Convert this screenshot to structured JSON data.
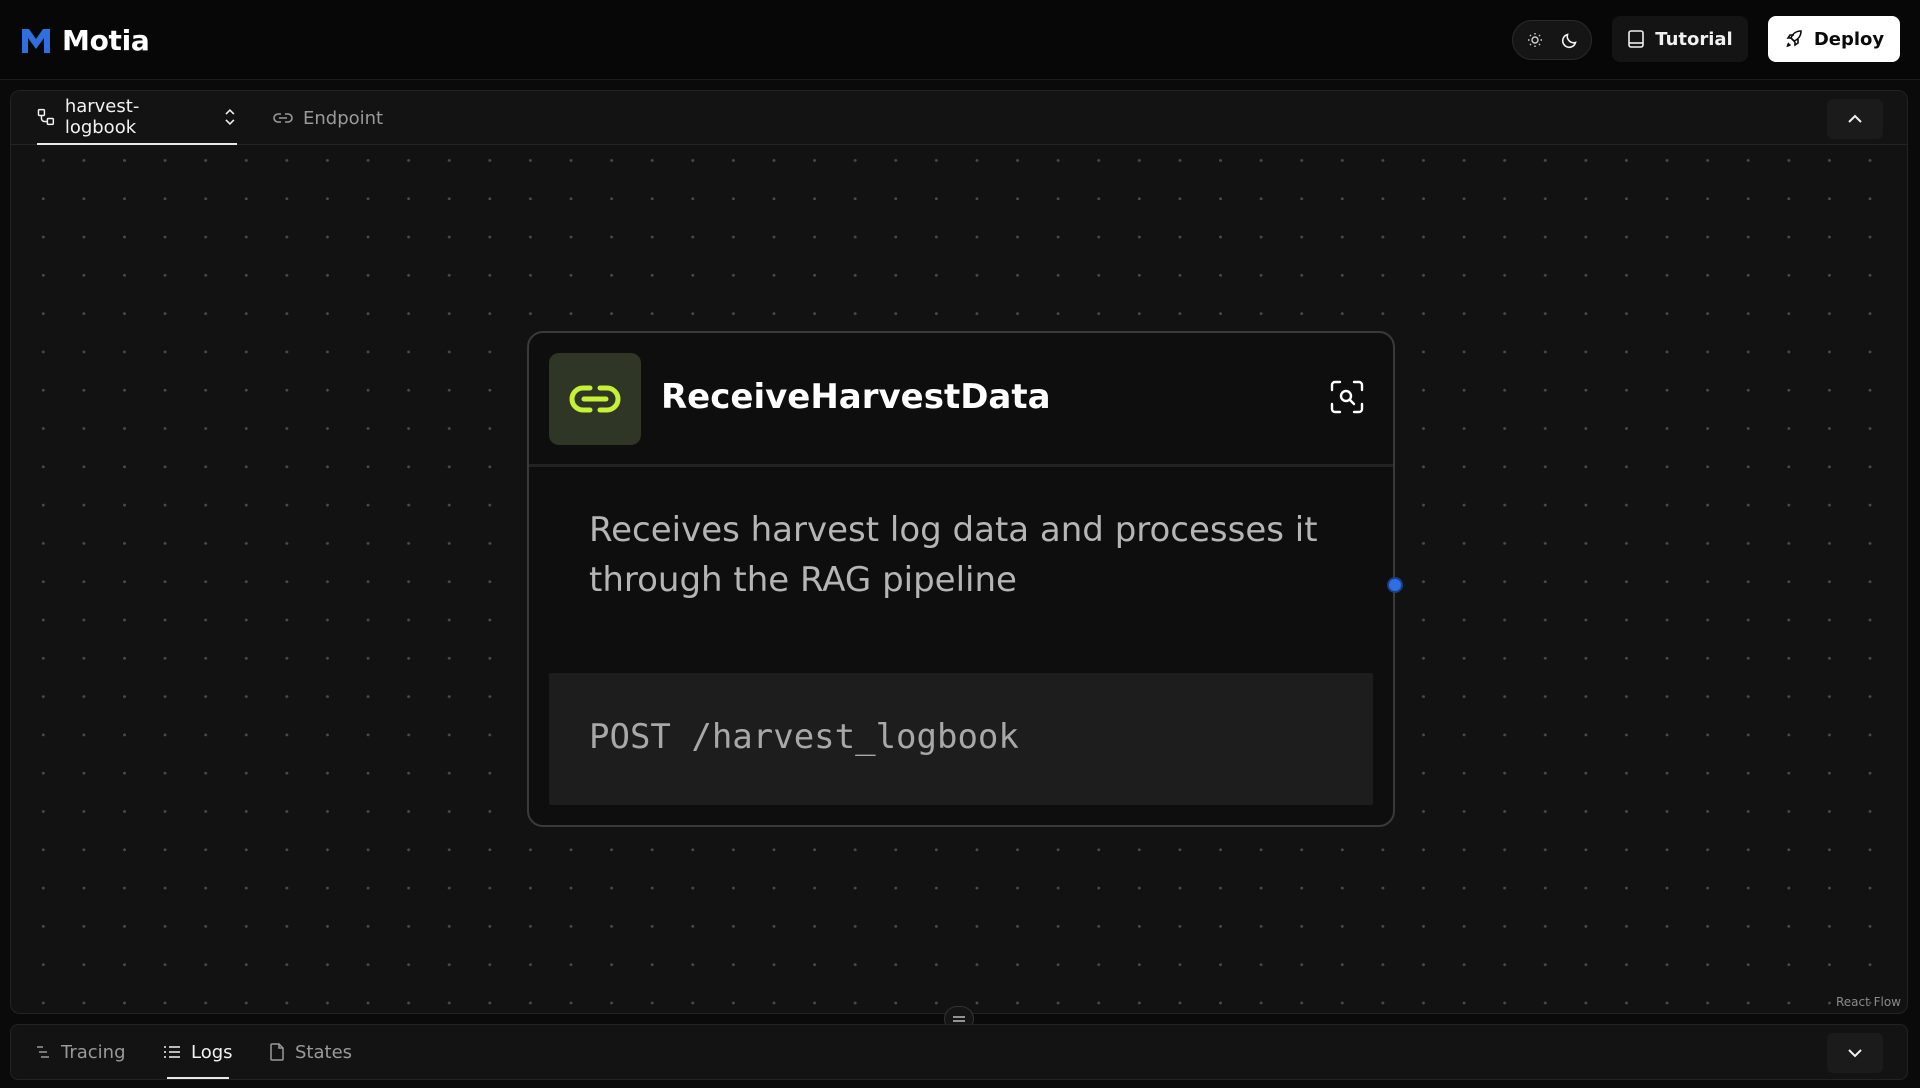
{
  "app": {
    "name": "Motia"
  },
  "header": {
    "theme_options": [
      "light",
      "dark"
    ],
    "tutorial_label": "Tutorial",
    "deploy_label": "Deploy"
  },
  "flow_tabs": {
    "flow_selector_label": "harvest-logbook",
    "endpoint_label": "Endpoint"
  },
  "node": {
    "title": "ReceiveHarvestData",
    "description": "Receives harvest log data and processes it through the RAG pipeline",
    "code": "POST /harvest_logbook",
    "icon": "link-icon",
    "accent_color": "#c6f135",
    "handle_color": "#2f6fe0"
  },
  "attribution": "React Flow",
  "bottom_tabs": [
    {
      "label": "Tracing",
      "icon": "tracing-icon",
      "active": false
    },
    {
      "label": "Logs",
      "icon": "list-icon",
      "active": true
    },
    {
      "label": "States",
      "icon": "file-icon",
      "active": false
    }
  ]
}
